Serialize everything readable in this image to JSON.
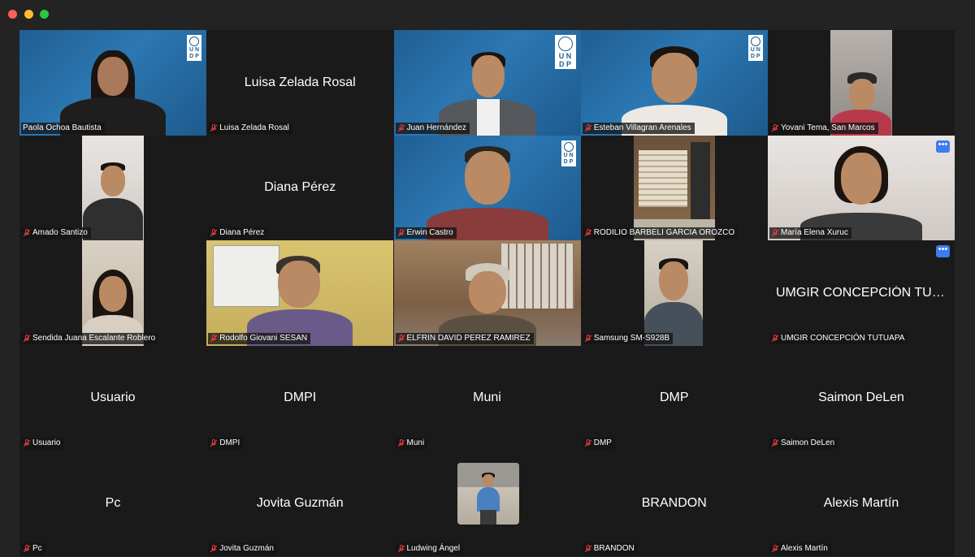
{
  "window": {
    "controls": [
      "close",
      "minimize",
      "zoom"
    ]
  },
  "participants": [
    {
      "name": "Paola Ochoa Bautista",
      "muted": false
    },
    {
      "name": "Luisa Zelada Rosal",
      "center_name": "Luisa Zelada Rosal",
      "muted": true
    },
    {
      "name": "Juan Hernández",
      "muted": true,
      "logo": "UNDP"
    },
    {
      "name": "Esteban Villagran Arenales",
      "muted": true,
      "logo": "UNDP"
    },
    {
      "name": "Yovani Tema, San Marcos",
      "muted": true
    },
    {
      "name": "Amado Santizo",
      "muted": true
    },
    {
      "name": "Diana Pérez",
      "center_name": "Diana Pérez",
      "muted": true
    },
    {
      "name": "Erwin Castro",
      "muted": true,
      "logo": "UNDP"
    },
    {
      "name": "RODILIO BARBELI GARCIA OROZCO",
      "muted": true
    },
    {
      "name": "María Elena Xuruc",
      "muted": true,
      "more": "•••"
    },
    {
      "name": "Sendida Juana Escalante Roblero",
      "muted": true
    },
    {
      "name": "Rodolfo Giovani SESAN",
      "muted": true
    },
    {
      "name": "ELFRIN DAVID PEREZ RAMIREZ",
      "muted": true
    },
    {
      "name": "Samsung SM-S928B",
      "muted": true
    },
    {
      "name": "UMGIR CONCEPCIÓN TUTUAPA",
      "center_name": "UMGIR CONCEPCIÓN TUT...",
      "muted": true,
      "more": "•••"
    },
    {
      "name": "Usuario",
      "center_name": "Usuario",
      "muted": true
    },
    {
      "name": "DMPI",
      "center_name": "DMPI",
      "muted": true
    },
    {
      "name": "Muni",
      "center_name": "Muni",
      "muted": true
    },
    {
      "name": "DMP",
      "center_name": "DMP",
      "muted": true
    },
    {
      "name": "Saimon DeLen",
      "center_name": "Saimon DeLen",
      "muted": true
    },
    {
      "name": "Pc",
      "center_name": "Pc",
      "muted": true
    },
    {
      "name": "Jovita Guzmán",
      "center_name": "Jovita Guzmán",
      "muted": true
    },
    {
      "name": "Ludwing Ángel",
      "muted": true
    },
    {
      "name": "BRANDON",
      "center_name": "BRANDON",
      "muted": true
    },
    {
      "name": "Alexis Martín",
      "center_name": "Alexis Martín",
      "muted": true
    }
  ],
  "logo": {
    "line1": "U N",
    "line2": "D P"
  },
  "colors": {
    "active_speaker": "#3ed55c",
    "mute": "#e03a3a",
    "more_button": "#3d7cf0"
  }
}
